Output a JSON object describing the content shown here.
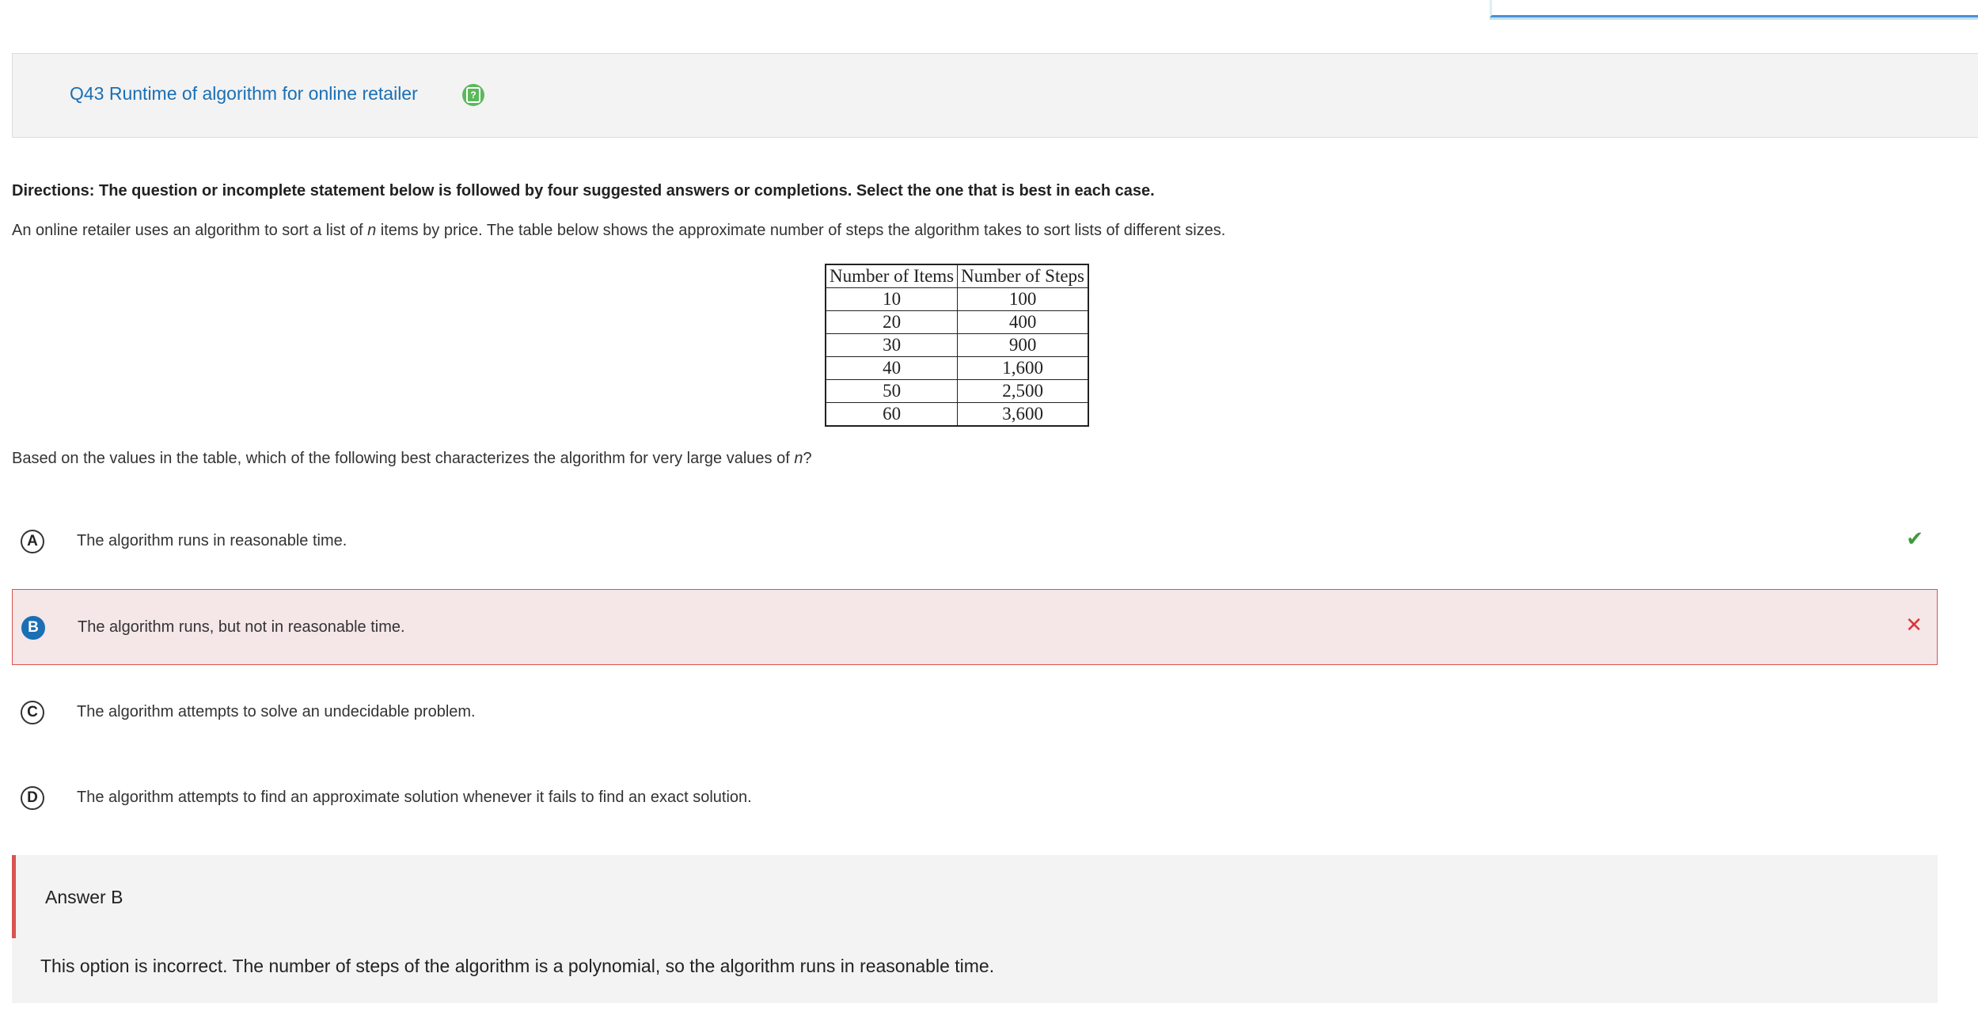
{
  "question": {
    "title": "Q43 Runtime of algorithm for online retailer",
    "help_icon": "help-icon"
  },
  "directions": "Directions: The question or incomplete statement below is followed by four suggested answers or completions. Select the one that is best in each case.",
  "stem": {
    "before": "An online retailer uses an algorithm to sort a list of ",
    "var": "n",
    "after": " items by price. The table below shows the approximate number of steps the algorithm takes to sort lists of different sizes."
  },
  "table": {
    "headers": [
      "Number of Items",
      "Number of Steps"
    ],
    "rows": [
      [
        "10",
        "100"
      ],
      [
        "20",
        "400"
      ],
      [
        "30",
        "900"
      ],
      [
        "40",
        "1,600"
      ],
      [
        "50",
        "2,500"
      ],
      [
        "60",
        "3,600"
      ]
    ]
  },
  "prompt": {
    "before": "Based on the values in the table, which of the following best characterizes the algorithm for very large values of ",
    "var": "n",
    "after": "?"
  },
  "choices": [
    {
      "letter": "A",
      "text": "The algorithm runs in reasonable time.",
      "status": "correct",
      "status_icon": "check-icon"
    },
    {
      "letter": "B",
      "text": "The algorithm runs, but not in reasonable time.",
      "status": "selected-incorrect",
      "status_icon": "close-icon"
    },
    {
      "letter": "C",
      "text": "The algorithm attempts to solve an undecidable problem.",
      "status": "none"
    },
    {
      "letter": "D",
      "text": "The algorithm attempts to find an approximate solution whenever it fails to find an exact solution.",
      "status": "none"
    }
  ],
  "answer": {
    "label": "Answer B",
    "explanation": "This option is incorrect. The number of steps of the algorithm is a polynomial, so the algorithm runs in reasonable time."
  },
  "colors": {
    "title_blue": "#1a6fb5",
    "help_green": "#5cb85c",
    "correct_green": "#3c9a3c",
    "incorrect_red": "#d9343a",
    "incorrect_bg": "#f5e6e8",
    "panel_gray": "#f3f3f3"
  }
}
